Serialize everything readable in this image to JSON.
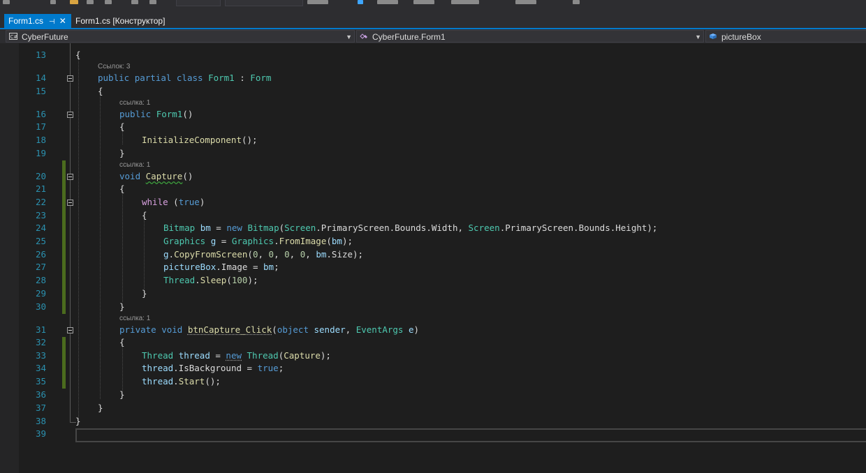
{
  "tabs": [
    {
      "label": "Form1.cs",
      "active": true,
      "pin": "⊣",
      "close": "✕"
    },
    {
      "label": "Form1.cs [Конструктор]",
      "active": false
    }
  ],
  "nav": {
    "project": "CyberFuture",
    "type": "CyberFuture.Form1",
    "member": "pictureBox"
  },
  "line_numbers": [
    "13",
    "14",
    "15",
    "16",
    "17",
    "18",
    "19",
    "20",
    "21",
    "22",
    "23",
    "24",
    "25",
    "26",
    "27",
    "28",
    "29",
    "30",
    "31",
    "32",
    "33",
    "34",
    "35",
    "36",
    "37",
    "38",
    "39"
  ],
  "codelens": [
    "Ссылок: 3",
    "ссылка: 1",
    "ссылка: 1",
    "ссылка: 1"
  ],
  "code": {
    "l13": [
      "{"
    ],
    "l14": [
      "public",
      " ",
      "partial",
      " ",
      "class",
      " ",
      "Form1",
      " : ",
      "Form"
    ],
    "l15": [
      "{"
    ],
    "l16": [
      "public",
      " ",
      "Form1",
      "()"
    ],
    "l17": [
      "{"
    ],
    "l18": [
      "InitializeComponent",
      "();"
    ],
    "l19": [
      "}"
    ],
    "l20": [
      "void",
      " ",
      "Capture",
      "()"
    ],
    "l21": [
      "{"
    ],
    "l22": [
      "while",
      " (",
      "true",
      ")"
    ],
    "l23": [
      "{"
    ],
    "l24": [
      "Bitmap",
      " ",
      "bm",
      " = ",
      "new",
      " ",
      "Bitmap",
      "(",
      "Screen",
      ".PrimaryScreen.Bounds.Width, ",
      "Screen",
      ".PrimaryScreen.Bounds.Height);"
    ],
    "l25": [
      "Graphics",
      " ",
      "g",
      " = ",
      "Graphics",
      ".",
      "FromImage",
      "(",
      "bm",
      ");"
    ],
    "l26": [
      "g",
      ".",
      "CopyFromScreen",
      "(",
      "0",
      ", ",
      "0",
      ", ",
      "0",
      ", ",
      "0",
      ", ",
      "bm",
      ".Size);"
    ],
    "l27": [
      "pictureBox",
      ".Image = ",
      "bm",
      ";"
    ],
    "l28": [
      "Thread",
      ".",
      "Sleep",
      "(",
      "100",
      ");"
    ],
    "l29": [
      "}"
    ],
    "l30": [
      "}"
    ],
    "l31": [
      "private",
      " ",
      "void",
      " ",
      "btnCapture_Click",
      "(",
      "object",
      " ",
      "sender",
      ", ",
      "EventArgs",
      " ",
      "e",
      ")"
    ],
    "l32": [
      "{"
    ],
    "l33": [
      "Thread",
      " ",
      "thread",
      " = ",
      "new",
      " ",
      "Thread",
      "(",
      "Capture",
      ");"
    ],
    "l34": [
      "thread",
      ".IsBackground = ",
      "true",
      ";"
    ],
    "l35": [
      "thread",
      ".",
      "Start",
      "();"
    ],
    "l36": [
      "}"
    ],
    "l37": [
      "}"
    ],
    "l38": [
      "}"
    ]
  },
  "colors": {
    "accent": "#007acc",
    "keyword": "#569cd6",
    "control": "#d8a0df",
    "type": "#4ec9b0",
    "method": "#dcdcaa",
    "variable": "#9cdcfe",
    "number": "#b5cea8",
    "line_number": "#2b91af"
  }
}
